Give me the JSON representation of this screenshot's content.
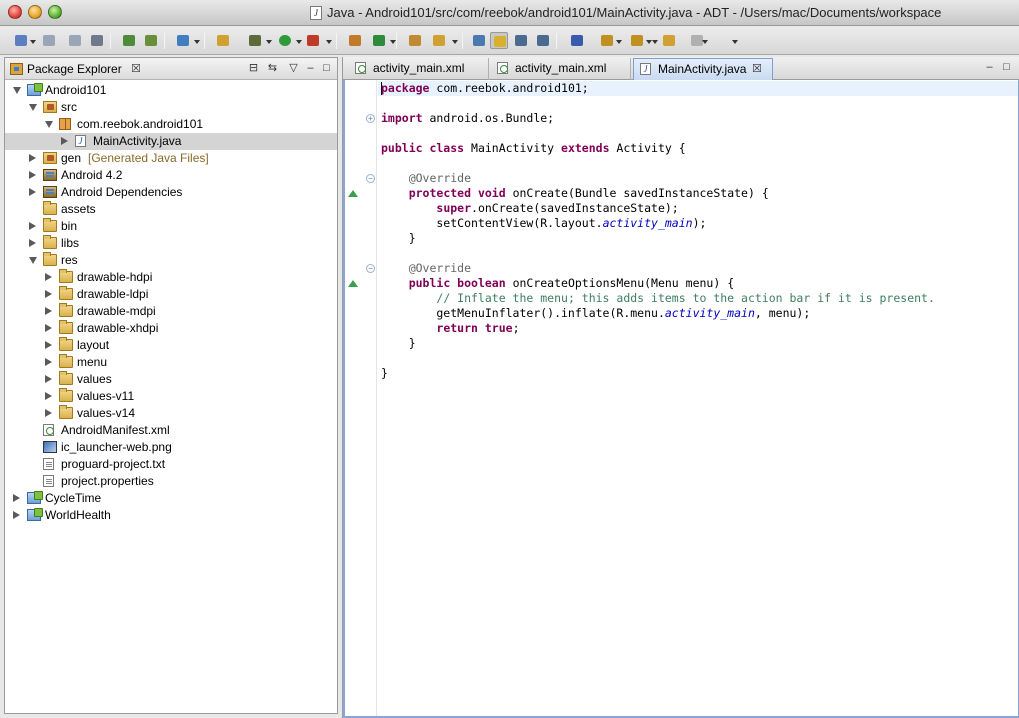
{
  "window": {
    "title": "Java - Android101/src/com/reebok/android101/MainActivity.java - ADT - /Users/mac/Documents/workspace"
  },
  "toolbar": {
    "buttons": [
      "new-wizard",
      "save",
      "save-all",
      "print",
      "open-type",
      "open-resource",
      "tasks",
      "new-android-app",
      "debug",
      "run",
      "run-last",
      "new-java-class",
      "build",
      "open-perspective",
      "search",
      "toggle-mark-occurrences",
      "toggle-block-selection",
      "show-whitespace",
      "pin-editor",
      "next-annotation",
      "previous-annotation",
      "last-edit-location",
      "back",
      "forward"
    ]
  },
  "package_explorer": {
    "title": "Package Explorer",
    "tree": [
      {
        "label": "Android101",
        "icon": "project-icon",
        "level": 0,
        "expanded": true
      },
      {
        "label": "src",
        "icon": "source-folder-icon",
        "level": 1,
        "expanded": true
      },
      {
        "label": "com.reebok.android101",
        "icon": "package-icon",
        "level": 2,
        "expanded": true
      },
      {
        "label": "MainActivity.java",
        "icon": "java-file-icon",
        "level": 3,
        "expanded": false,
        "selected": true
      },
      {
        "label": "gen",
        "decoration": "[Generated Java Files]",
        "icon": "source-folder-icon",
        "level": 1,
        "expanded": false
      },
      {
        "label": "Android 4.2",
        "icon": "library-icon",
        "level": 1,
        "expanded": false
      },
      {
        "label": "Android Dependencies",
        "icon": "library-icon",
        "level": 1,
        "expanded": false
      },
      {
        "label": "assets",
        "icon": "folder-icon",
        "level": 1,
        "leaf": true
      },
      {
        "label": "bin",
        "icon": "folder-icon",
        "level": 1,
        "expanded": false
      },
      {
        "label": "libs",
        "icon": "folder-icon",
        "level": 1,
        "expanded": false
      },
      {
        "label": "res",
        "icon": "folder-icon",
        "level": 1,
        "expanded": true
      },
      {
        "label": "drawable-hdpi",
        "icon": "folder-icon",
        "level": 2,
        "expanded": false
      },
      {
        "label": "drawable-ldpi",
        "icon": "folder-icon",
        "level": 2,
        "expanded": false
      },
      {
        "label": "drawable-mdpi",
        "icon": "folder-icon",
        "level": 2,
        "expanded": false
      },
      {
        "label": "drawable-xhdpi",
        "icon": "folder-icon",
        "level": 2,
        "expanded": false
      },
      {
        "label": "layout",
        "icon": "folder-icon",
        "level": 2,
        "expanded": false
      },
      {
        "label": "menu",
        "icon": "folder-icon",
        "level": 2,
        "expanded": false
      },
      {
        "label": "values",
        "icon": "folder-icon",
        "level": 2,
        "expanded": false
      },
      {
        "label": "values-v11",
        "icon": "folder-icon",
        "level": 2,
        "expanded": false
      },
      {
        "label": "values-v14",
        "icon": "folder-icon",
        "level": 2,
        "expanded": false
      },
      {
        "label": "AndroidManifest.xml",
        "icon": "xml-file-icon",
        "level": 1,
        "leaf": true
      },
      {
        "label": "ic_launcher-web.png",
        "icon": "image-file-icon",
        "level": 1,
        "leaf": true
      },
      {
        "label": "proguard-project.txt",
        "icon": "text-file-icon",
        "level": 1,
        "leaf": true
      },
      {
        "label": "project.properties",
        "icon": "text-file-icon",
        "level": 1,
        "leaf": true
      },
      {
        "label": "CycleTime",
        "icon": "project-icon",
        "level": 0,
        "expanded": false
      },
      {
        "label": "WorldHealth",
        "icon": "project-icon",
        "level": 0,
        "expanded": false
      }
    ]
  },
  "editor": {
    "tabs": [
      {
        "label": "activity_main.xml",
        "icon": "xml-file-icon",
        "active": false
      },
      {
        "label": "activity_main.xml",
        "icon": "xml-file-icon",
        "active": false
      },
      {
        "label": "MainActivity.java",
        "icon": "java-file-icon",
        "active": true
      }
    ],
    "code_lines": [
      [
        [
          "kw",
          "package"
        ],
        [
          "t",
          " com.reebok.android101;"
        ]
      ],
      [],
      [
        [
          "kw",
          "import"
        ],
        [
          "t",
          " android.os.Bundle;"
        ]
      ],
      [],
      [
        [
          "kw",
          "public class"
        ],
        [
          "t",
          " MainActivity "
        ],
        [
          "kw",
          "extends"
        ],
        [
          "t",
          " Activity {"
        ]
      ],
      [],
      [
        [
          "t",
          "    "
        ],
        [
          "an",
          "@Override"
        ]
      ],
      [
        [
          "t",
          "    "
        ],
        [
          "kw",
          "protected void"
        ],
        [
          "t",
          " onCreate(Bundle savedInstanceState) {"
        ]
      ],
      [
        [
          "t",
          "        "
        ],
        [
          "kw",
          "super"
        ],
        [
          "t",
          ".onCreate(savedInstanceState);"
        ]
      ],
      [
        [
          "t",
          "        setContentView(R.layout."
        ],
        [
          "fi",
          "activity_main"
        ],
        [
          "t",
          ");"
        ]
      ],
      [
        [
          "t",
          "    }"
        ]
      ],
      [],
      [
        [
          "t",
          "    "
        ],
        [
          "an",
          "@Override"
        ]
      ],
      [
        [
          "t",
          "    "
        ],
        [
          "kw",
          "public boolean"
        ],
        [
          "t",
          " onCreateOptionsMenu(Menu menu) {"
        ]
      ],
      [
        [
          "t",
          "        "
        ],
        [
          "cm",
          "// Inflate the menu; this adds items to the action bar if it is present."
        ]
      ],
      [
        [
          "t",
          "        getMenuInflater().inflate(R.menu."
        ],
        [
          "fi",
          "activity_main"
        ],
        [
          "t",
          ", menu);"
        ]
      ],
      [
        [
          "t",
          "        "
        ],
        [
          "kw",
          "return true"
        ],
        [
          "t",
          ";"
        ]
      ],
      [
        [
          "t",
          "    }"
        ]
      ],
      [],
      [
        [
          "t",
          "}"
        ]
      ]
    ]
  },
  "colors": {
    "keyword": "#7f0055",
    "annotation": "#646464",
    "comment": "#3f7f5f",
    "field": "#0000c0",
    "active_tab": "#c9daf1",
    "selection": "#d4d4d4"
  }
}
